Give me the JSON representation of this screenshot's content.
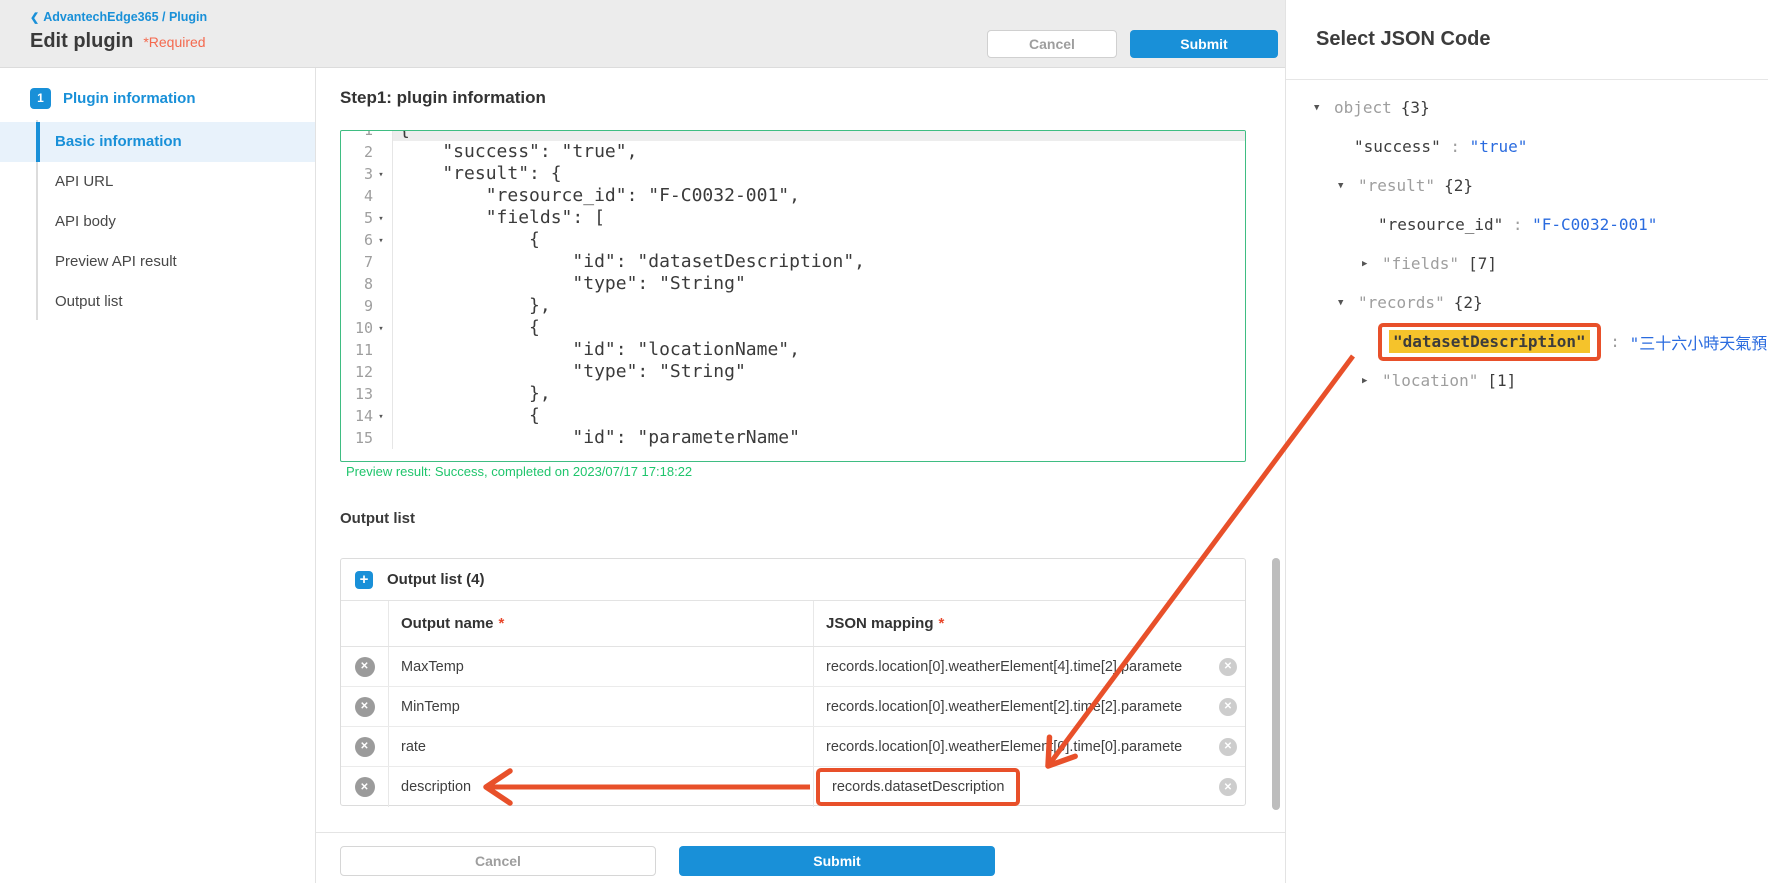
{
  "colors": {
    "accent_blue": "#1990d8",
    "annotation_orange": "#e8502a",
    "highlight_yellow": "#f5c32b",
    "editor_border_green": "#3fbd82",
    "success_text_green": "#1fc56c",
    "json_value_blue": "#2a6bdf"
  },
  "header": {
    "breadcrumb": "AdvantechEdge365 / Plugin",
    "title": "Edit plugin",
    "required_note": "*Required",
    "cancel_label": "Cancel",
    "submit_label": "Submit"
  },
  "sidebar": {
    "step_number": "1",
    "step_label": "Plugin information",
    "items": [
      {
        "label": "Basic information",
        "active": true
      },
      {
        "label": "API URL",
        "active": false
      },
      {
        "label": "API body",
        "active": false
      },
      {
        "label": "Preview API result",
        "active": false
      },
      {
        "label": "Output list",
        "active": false
      }
    ]
  },
  "main": {
    "section_title": "Step1: plugin information",
    "editor": {
      "lines": [
        {
          "n": 1,
          "fold": false,
          "text": "{"
        },
        {
          "n": 2,
          "fold": false,
          "text": "    \"success\": \"true\","
        },
        {
          "n": 3,
          "fold": true,
          "text": "    \"result\": {"
        },
        {
          "n": 4,
          "fold": false,
          "text": "        \"resource_id\": \"F-C0032-001\","
        },
        {
          "n": 5,
          "fold": true,
          "text": "        \"fields\": ["
        },
        {
          "n": 6,
          "fold": true,
          "text": "            {"
        },
        {
          "n": 7,
          "fold": false,
          "text": "                \"id\": \"datasetDescription\","
        },
        {
          "n": 8,
          "fold": false,
          "text": "                \"type\": \"String\""
        },
        {
          "n": 9,
          "fold": false,
          "text": "            },"
        },
        {
          "n": 10,
          "fold": true,
          "text": "            {"
        },
        {
          "n": 11,
          "fold": false,
          "text": "                \"id\": \"locationName\","
        },
        {
          "n": 12,
          "fold": false,
          "text": "                \"type\": \"String\""
        },
        {
          "n": 13,
          "fold": false,
          "text": "            },"
        },
        {
          "n": 14,
          "fold": true,
          "text": "            {"
        },
        {
          "n": 15,
          "fold": false,
          "text": "                \"id\": \"parameterName\""
        }
      ]
    },
    "preview_result": "Preview result: Success, completed on 2023/07/17 17:18:22",
    "output_list_label": "Output list",
    "output_table": {
      "title": "Output list (4)",
      "columns": [
        "Output name",
        "JSON mapping"
      ],
      "required_mark": "*",
      "rows": [
        {
          "name": "MaxTemp",
          "mapping": "records.location[0].weatherElement[4].time[2].paramete",
          "highlight": false
        },
        {
          "name": "MinTemp",
          "mapping": "records.location[0].weatherElement[2].time[2].paramete",
          "highlight": false
        },
        {
          "name": "rate",
          "mapping": "records.location[0].weatherElement[0].time[0].paramete",
          "highlight": false
        },
        {
          "name": "description",
          "mapping": "records.datasetDescription",
          "highlight": true
        }
      ]
    },
    "cancel_label": "Cancel",
    "submit_label": "Submit"
  },
  "json_panel": {
    "title": "Select JSON Code",
    "tree": [
      {
        "indent": 0,
        "arrow": "down",
        "key": "object",
        "key_style": "plain",
        "suffix": "{3}"
      },
      {
        "indent": 1,
        "arrow": null,
        "key": "\"success\"",
        "key_style": "dark",
        "colon": true,
        "value": "\"true\""
      },
      {
        "indent": 1,
        "arrow": "down",
        "key": "\"result\"",
        "key_style": "gray",
        "suffix": "{2}"
      },
      {
        "indent": 2,
        "arrow": null,
        "key": "\"resource_id\"",
        "key_style": "dark",
        "colon": true,
        "value": "\"F-C0032-001\""
      },
      {
        "indent": 2,
        "arrow": "right",
        "key": "\"fields\"",
        "key_style": "gray",
        "suffix": "[7]"
      },
      {
        "indent": 1,
        "arrow": "down",
        "key": "\"records\"",
        "key_style": "gray",
        "suffix": "{2}"
      },
      {
        "indent": 2,
        "arrow": null,
        "key": "\"datasetDescription\"",
        "key_style": "boxed",
        "colon": true,
        "value": "\"三十六小時天氣預報\""
      },
      {
        "indent": 2,
        "arrow": "right",
        "key": "\"location\"",
        "key_style": "gray",
        "suffix": "[1]"
      }
    ]
  }
}
